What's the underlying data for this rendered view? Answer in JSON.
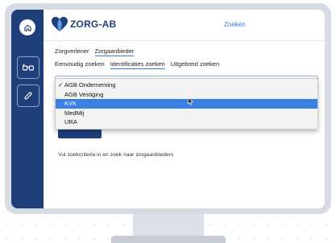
{
  "app": {
    "logo_text": "ZORG-AB",
    "search_link": "Zoeken"
  },
  "nav": {
    "tabs_row1": [
      "Zorgverlener",
      "Zorgaanbieder"
    ],
    "tabs_row2": [
      "Eenvoudig zoeken",
      "Identificaties zoeken",
      "Uitgebreid zoeken"
    ]
  },
  "dropdown": {
    "selected": "AGB Onderneming",
    "highlighted": "KVK",
    "options": [
      {
        "label": "AGB Onderneming",
        "checked": "✓"
      },
      {
        "label": "AGB Vestiging",
        "checked": ""
      },
      {
        "label": "KVK",
        "checked": ""
      },
      {
        "label": "MedMij",
        "checked": ""
      },
      {
        "label": "URA",
        "checked": ""
      }
    ]
  },
  "hint": "Vul zoekcriteria in en zoek naar zorgaanbieders",
  "colors": {
    "brand_navy": "#1f3f7a",
    "accent_blue": "#3a7bd5",
    "highlight": "#3b7fe0"
  },
  "icons": {
    "home": "home-icon",
    "glasses": "glasses-icon",
    "pencil": "pencil-icon",
    "logo": "heart-logo-icon"
  }
}
